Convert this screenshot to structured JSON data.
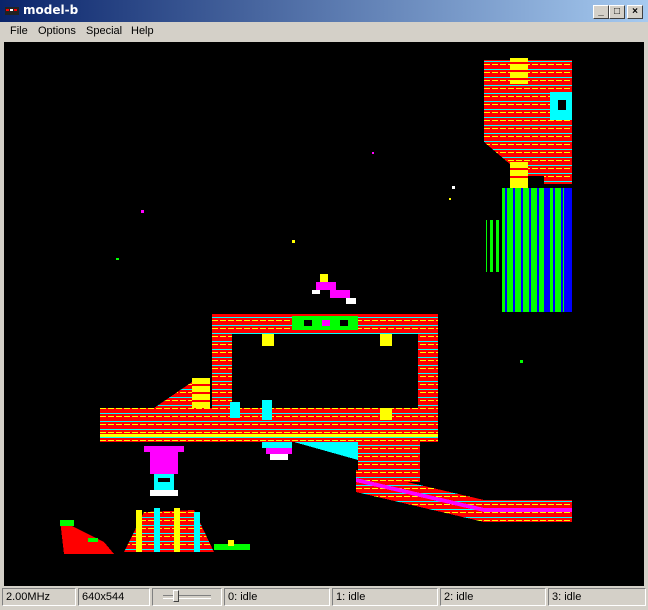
{
  "window": {
    "title": "model-b",
    "controls": {
      "minimize": "_",
      "maximize": "□",
      "close": "×"
    }
  },
  "menu": {
    "items": [
      {
        "label": "File"
      },
      {
        "label": "Options"
      },
      {
        "label": "Special"
      },
      {
        "label": "Help"
      }
    ]
  },
  "status": {
    "clock": "2.00MHz",
    "resolution": "640x544",
    "drives": [
      {
        "label": "0: idle"
      },
      {
        "label": "1: idle"
      },
      {
        "label": "2: idle"
      },
      {
        "label": "3: idle"
      }
    ]
  },
  "colors": {
    "title_bar_start": "#0a246a",
    "title_bar_end": "#a6caf0",
    "screen_bg": "#000000",
    "red": "#ff0000",
    "cyan": "#00ffff",
    "magenta": "#ff00ff",
    "yellow": "#ffff00",
    "green": "#00ff00",
    "blue": "#0000ff",
    "white": "#ffffff"
  }
}
